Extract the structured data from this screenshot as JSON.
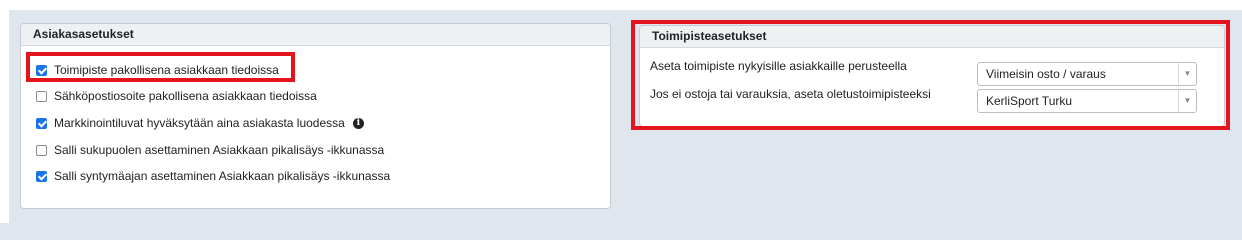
{
  "customer_settings": {
    "title": "Asiakasasetukset",
    "options": [
      {
        "label": "Toimipiste pakollisena asiakkaan tiedoissa",
        "checked": true
      },
      {
        "label": "Sähköpostiosoite pakollisena asiakkaan tiedoissa",
        "checked": false
      },
      {
        "label": "Markkinointiluvat hyväksytään aina asiakasta luodessa",
        "checked": true,
        "info_icon": "info-icon"
      },
      {
        "label": "Salli sukupuolen asettaminen Asiakkaan pikalisäys -ikkunassa",
        "checked": false
      },
      {
        "label": "Salli syntymäajan asettaminen Asiakkaan pikalisäys -ikkunassa",
        "checked": true
      }
    ]
  },
  "location_settings": {
    "title": "Toimipisteasetukset",
    "rows": [
      {
        "label": "Aseta toimipiste nykyisille asiakkaille perusteella",
        "value": "Viimeisin osto / varaus"
      },
      {
        "label": "Jos ei ostoja tai varauksia, aseta oletustoimipisteeksi",
        "value": "KerliSport Turku"
      }
    ]
  },
  "colors": {
    "highlight": "#e3141d",
    "checkbox_checked": "#1a73e8",
    "background": "#dfe6ee"
  }
}
